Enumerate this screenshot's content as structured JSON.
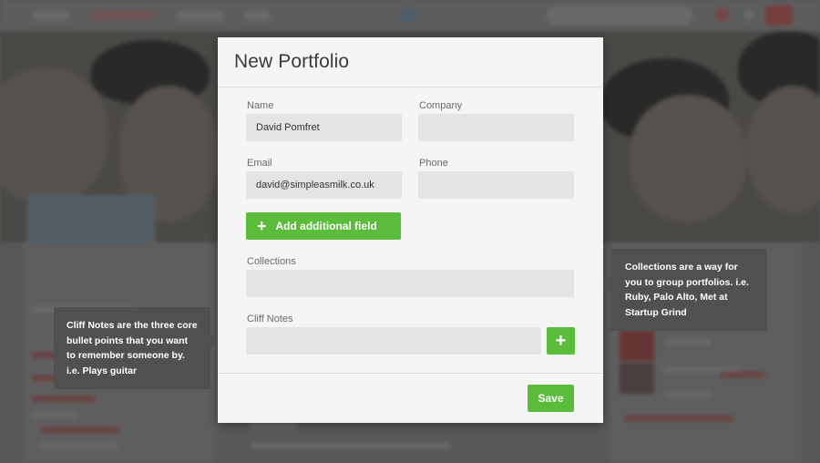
{
  "modal": {
    "title": "New Portfolio",
    "fields": {
      "name": {
        "label": "Name",
        "value": "David Pomfret"
      },
      "company": {
        "label": "Company",
        "value": ""
      },
      "email": {
        "label": "Email",
        "value": "david@simpleasmilk.co.uk"
      },
      "phone": {
        "label": "Phone",
        "value": ""
      },
      "collections": {
        "label": "Collections",
        "value": ""
      },
      "cliff_notes": {
        "label": "Cliff Notes",
        "value": ""
      }
    },
    "add_field_label": "Add additional field",
    "plus_symbol": "+",
    "save_label": "Save"
  },
  "tooltips": {
    "cliff_notes": "Cliff Notes are the three core bullet points that you want to remember someone by. i.e. Plays guitar",
    "collections": "Collections are a way for you to group portfolios.  i.e. Ruby, Palo Alto, Met at Startup Grind"
  },
  "colors": {
    "accent_green": "#5bbc3c",
    "tooltip_bg": "#505050",
    "modal_bg": "#f5f5f5",
    "input_bg": "#e4e4e4"
  },
  "icons": {
    "add_field": "plus-icon",
    "cliff_add": "plus-icon"
  }
}
